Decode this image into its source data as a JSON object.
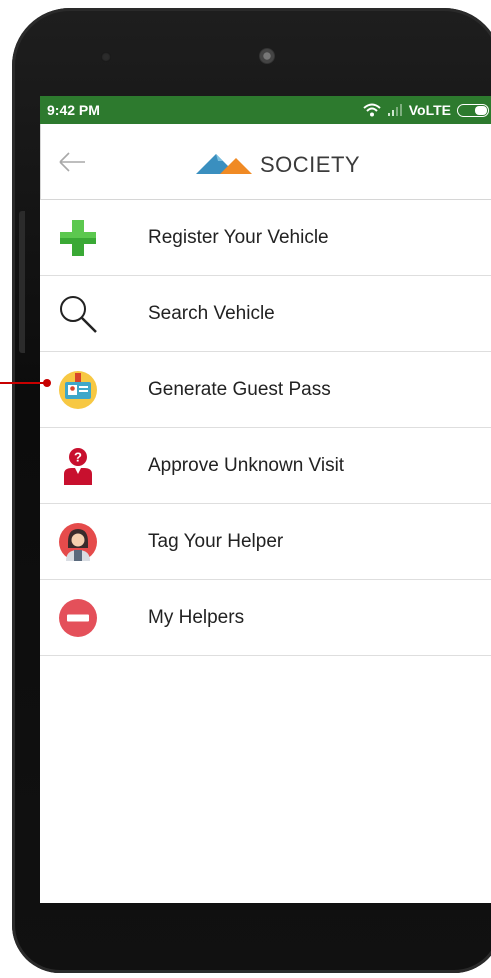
{
  "status_bar": {
    "time": "9:42 PM",
    "network": "VoLTE"
  },
  "app_bar": {
    "logo_text": "SOCIETY"
  },
  "menu": [
    {
      "label": "Register Your Vehicle",
      "icon": "plus-icon"
    },
    {
      "label": "Search Vehicle",
      "icon": "search-icon"
    },
    {
      "label": "Generate Guest Pass",
      "icon": "id-badge-icon"
    },
    {
      "label": "Approve Unknown Visit",
      "icon": "unknown-person-icon"
    },
    {
      "label": "Tag Your Helper",
      "icon": "helper-icon"
    },
    {
      "label": "My Helpers",
      "icon": "minus-circle-icon"
    }
  ],
  "colors": {
    "status_bar": "#2d7a2e",
    "accent_orange": "#f08a24",
    "accent_blue": "#3a8fbf",
    "pointer": "#c80000"
  }
}
